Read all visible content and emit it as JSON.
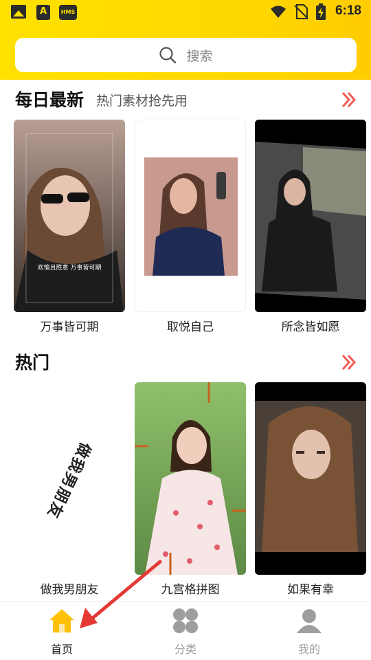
{
  "status_bar": {
    "time": "6:18",
    "left_icons": [
      "gallery-icon",
      "font-a-icon",
      "hms-icon"
    ],
    "hms_label": "HMS",
    "a_label": "A",
    "right_icons": [
      "wifi-icon",
      "no-sim-icon",
      "battery-charging-icon"
    ]
  },
  "search": {
    "placeholder": "搜索",
    "icon": "search-icon"
  },
  "daily": {
    "title": "每日最新",
    "subtitle": "热门素材抢先用",
    "more_icon": "double-chevron-right-icon",
    "items": [
      {
        "caption": "万事皆可期",
        "overlay_text": "欢愉且胜意 万事皆可期"
      },
      {
        "caption": "取悦自己"
      },
      {
        "caption": "所念皆如愿"
      }
    ]
  },
  "hot": {
    "title": "热门",
    "more_icon": "double-chevron-right-icon",
    "items": [
      {
        "caption": "做我男朋友",
        "overlay_text": "做我男朋友"
      },
      {
        "caption": "九宫格拼图"
      },
      {
        "caption": "如果有幸"
      }
    ]
  },
  "nav": {
    "items": [
      {
        "label": "首页",
        "icon": "home-icon",
        "active": true
      },
      {
        "label": "分类",
        "icon": "category-icon",
        "active": false
      },
      {
        "label": "我的",
        "icon": "profile-icon",
        "active": false
      }
    ]
  },
  "colors": {
    "header_yellow": "#ffe100",
    "accent_red": "#f25c54",
    "nav_active": "#ffc107",
    "nav_inactive": "#9e9e9e",
    "annotation_arrow": "#e53935"
  }
}
